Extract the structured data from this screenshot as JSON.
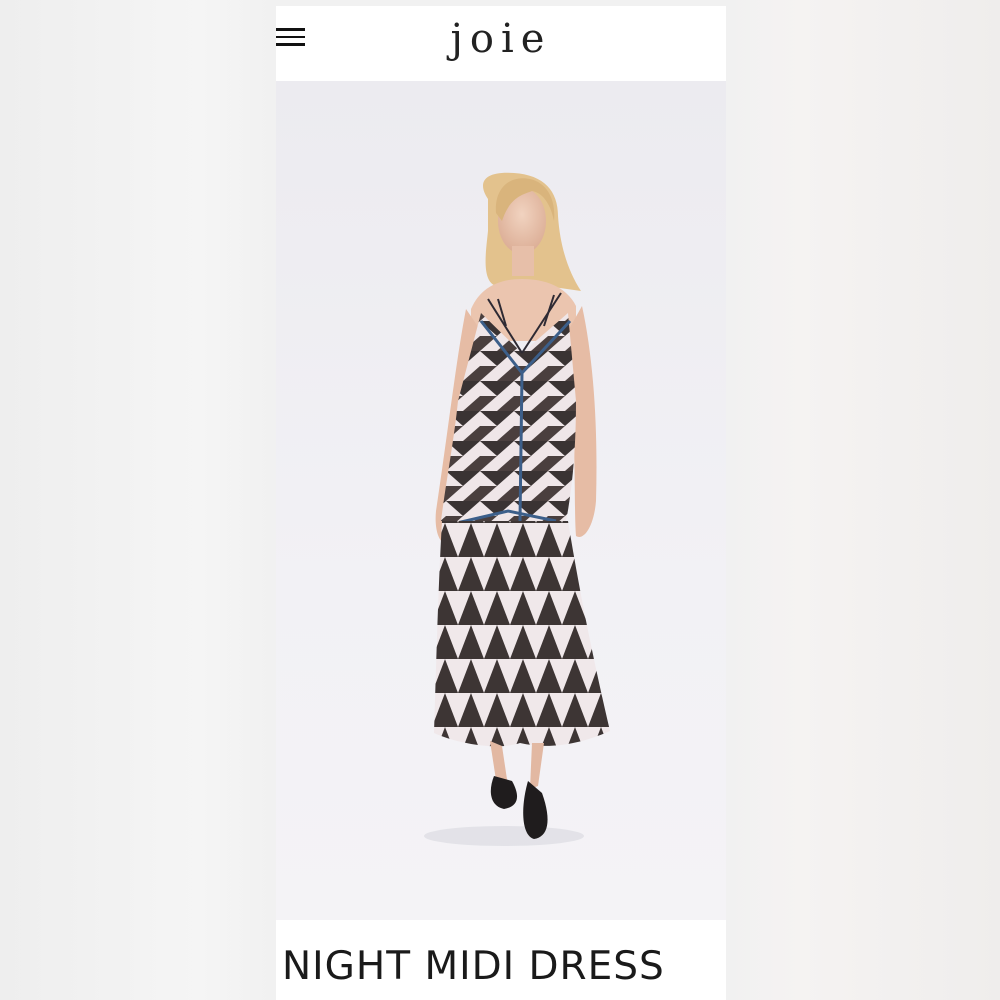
{
  "header": {
    "menu_icon": "hamburger-menu-icon",
    "brand": "joie"
  },
  "product": {
    "image_alt": "Model wearing geometric print slip midi dress",
    "title": "NIGHT MIDI DRESS"
  },
  "colors": {
    "page_background": "#ffffff",
    "hero_background": "#eeedf2",
    "text": "#1a1a1a"
  }
}
